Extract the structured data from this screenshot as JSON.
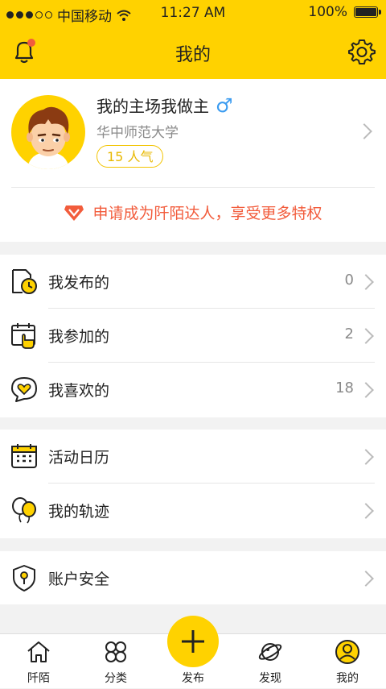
{
  "status": {
    "carrier": "中国移动",
    "time": "11:27 AM",
    "battery": "100%",
    "battery_level": 1.0
  },
  "nav": {
    "title": "我的"
  },
  "profile": {
    "name": "我的主场我做主",
    "gender_symbol": "♂",
    "school": "华中师范大学",
    "popularity": "15 人气",
    "apply_text": "申请成为阡陌达人，享受更多特权"
  },
  "list1": [
    {
      "label": "我发布的",
      "count": "0",
      "icon": "document-clock-icon"
    },
    {
      "label": "我参加的",
      "count": "2",
      "icon": "calendar-tap-icon"
    },
    {
      "label": "我喜欢的",
      "count": "18",
      "icon": "heart-bubble-icon"
    }
  ],
  "list2": [
    {
      "label": "活动日历",
      "icon": "calendar-icon"
    },
    {
      "label": "我的轨迹",
      "icon": "balloons-icon"
    }
  ],
  "list3": [
    {
      "label": "账户安全",
      "icon": "shield-icon"
    }
  ],
  "tabs": [
    {
      "label": "阡陌",
      "icon": "home-icon"
    },
    {
      "label": "分类",
      "icon": "category-icon"
    },
    {
      "label": "发布",
      "icon": "plus-icon"
    },
    {
      "label": "发现",
      "icon": "planet-icon"
    },
    {
      "label": "我的",
      "icon": "user-icon"
    }
  ],
  "colors": {
    "accent": "#ffd200",
    "alert": "#f25c3c",
    "male": "#3a9bf0"
  }
}
